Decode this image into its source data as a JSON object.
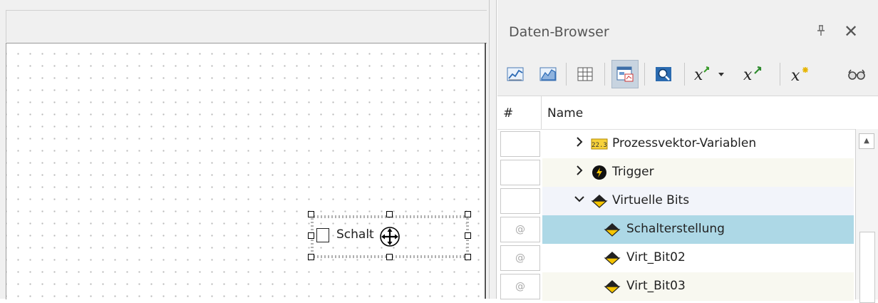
{
  "designer": {
    "switch_label": "Schalt"
  },
  "data_browser": {
    "title": "Daten-Browser",
    "pin_icon": "pin-icon",
    "close_label": "✕",
    "toolbar": [
      {
        "name": "line-chart-icon",
        "active": false
      },
      {
        "name": "area-chart-icon",
        "active": false
      },
      {
        "name": "table-icon",
        "active": false
      },
      {
        "name": "curve-window-icon",
        "active": true
      },
      {
        "name": "zoom-icon",
        "active": false
      },
      {
        "name": "formula-dropdown-icon",
        "active": false
      },
      {
        "name": "formula-export-icon",
        "active": false
      },
      {
        "name": "formula-new-icon",
        "active": false
      },
      {
        "name": "glasses-icon",
        "active": false
      }
    ],
    "columns": {
      "index": "#",
      "name": "Name"
    },
    "rows": [
      {
        "index": "",
        "expand": "›",
        "icon": "process-vector-icon",
        "label": "Prozessvektor-Variablen",
        "level": 1,
        "selected": false
      },
      {
        "index": "",
        "expand": "›",
        "icon": "trigger-icon",
        "label": "Trigger",
        "level": 1,
        "selected": false
      },
      {
        "index": "",
        "expand": "⌄",
        "icon": "virtual-bit-icon",
        "label": "Virtuelle Bits",
        "level": 1,
        "selected": false
      },
      {
        "index": "@",
        "expand": "",
        "icon": "virtual-bit-icon",
        "label": "Schalterstellung",
        "level": 2,
        "selected": true
      },
      {
        "index": "@",
        "expand": "",
        "icon": "virtual-bit-icon",
        "label": "Virt_Bit02",
        "level": 2,
        "selected": false
      },
      {
        "index": "@",
        "expand": "",
        "icon": "virtual-bit-icon",
        "label": "Virt_Bit03",
        "level": 2,
        "selected": false
      }
    ],
    "colors": {
      "selected_row": "#add8e6",
      "row_alt": "#f8f8f0",
      "row_plain": "#ffffff"
    }
  }
}
